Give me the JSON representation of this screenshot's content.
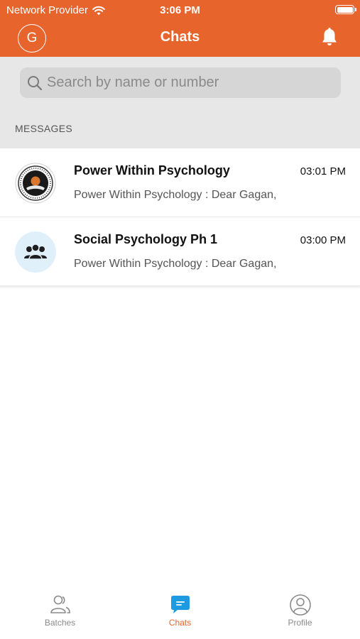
{
  "status_bar": {
    "carrier": "Network Provider",
    "time": "3:06 PM"
  },
  "nav": {
    "avatar_initial": "G",
    "title": "Chats"
  },
  "search": {
    "placeholder": "Search by name or number"
  },
  "section": {
    "label": "MESSAGES"
  },
  "chats": [
    {
      "name": "Power Within Psychology",
      "time": "03:01 PM",
      "preview": "Power Within Psychology : Dear Gagan,",
      "avatar_icon": "organization-logo-icon"
    },
    {
      "name": "Social Psychology Ph 1",
      "time": "03:00 PM",
      "preview": "Power Within Psychology : Dear Gagan,",
      "avatar_icon": "group-icon"
    }
  ],
  "tabs": [
    {
      "label": "Batches",
      "icon": "batches-icon",
      "active": false
    },
    {
      "label": "Chats",
      "icon": "chat-icon",
      "active": true
    },
    {
      "label": "Profile",
      "icon": "profile-icon",
      "active": false
    }
  ],
  "colors": {
    "accent": "#e8642d",
    "search_background": "#e7e7e7",
    "active_tab": "#1e9ae0"
  }
}
